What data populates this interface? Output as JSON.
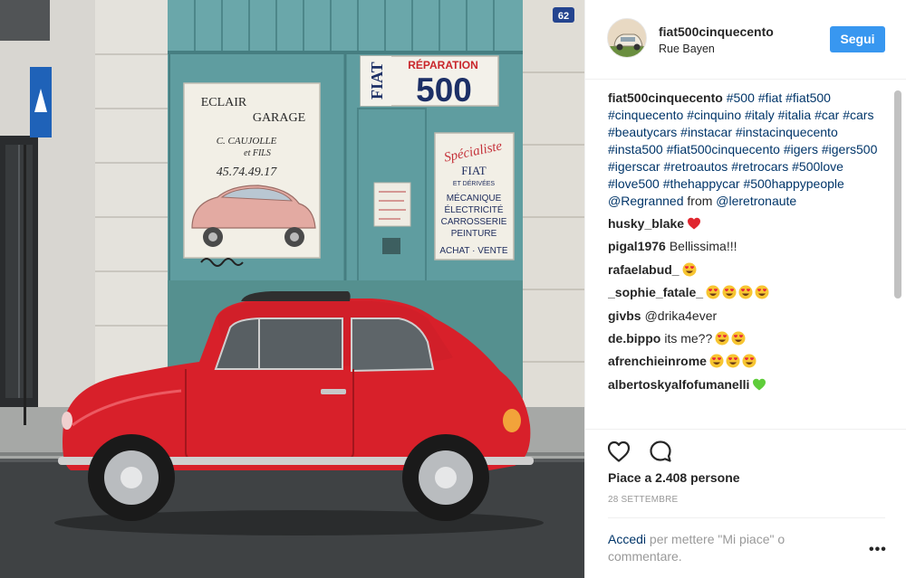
{
  "post": {
    "username": "fiat500cinquecento",
    "location": "Rue Bayen",
    "follow_label": "Segui",
    "photo_signs": {
      "house_number": "62",
      "left_sign": [
        "ECLAIR",
        "GARAGE",
        "C. CAUJOLLE",
        "et FILS",
        "45.74.49.17"
      ],
      "fiat_brand": "FIAT",
      "reparation": "RÉPARATION",
      "model": "500",
      "right_sign": [
        "Spécialiste",
        "FIAT",
        "ET DÉRIVÉES",
        "MÉCANIQUE",
        "ÉLECTRICITÉ",
        "CARROSSERIE",
        "PEINTURE",
        "ACHAT · VENTE"
      ]
    }
  },
  "caption": {
    "username": "fiat500cinquecento",
    "hashtags": [
      "#500",
      "#fiat",
      "#fiat500",
      "#cinquecento",
      "#cinquino",
      "#italy",
      "#italia",
      "#car",
      "#cars",
      "#beautycars",
      "#instacar",
      "#instacinquecento",
      "#insta500",
      "#fiat500cinquecento",
      "#igers",
      "#igers500",
      "#igerscar",
      "#retroautos",
      "#retrocars",
      "#500love",
      "#love500",
      "#thehappycar",
      "#500happypeople"
    ],
    "mention": "@Regranned",
    "from_word": "from",
    "credit": "@leretronaute"
  },
  "comments": [
    {
      "user": "husky_blake",
      "text": "",
      "emoji": [
        "red-heart"
      ]
    },
    {
      "user": "pigal1976",
      "text": "Bellissima!!!",
      "emoji": []
    },
    {
      "user": "rafaelabud_",
      "text": "",
      "emoji": [
        "heart-eyes"
      ]
    },
    {
      "user": "_sophie_fatale_",
      "text": "",
      "emoji": [
        "heart-eyes",
        "heart-eyes",
        "heart-eyes",
        "heart-eyes"
      ]
    },
    {
      "user": "givbs",
      "text": "@drika4ever",
      "text_is_link": true,
      "emoji": []
    },
    {
      "user": "de.bippo",
      "text": "its me??",
      "emoji": [
        "heart-eyes",
        "heart-eyes"
      ]
    },
    {
      "user": "afrenchieinrome",
      "text": "",
      "emoji": [
        "heart-eyes",
        "heart-eyes",
        "heart-eyes"
      ]
    },
    {
      "user": "albertoskyalfofumanelli",
      "text": "",
      "emoji": [
        "green-heart"
      ]
    }
  ],
  "actions": {
    "like_icon": "heart-outline-icon",
    "comment_icon": "comment-bubble-icon"
  },
  "likes_text": "Piace a 2.408 persone",
  "date": "28 SETTEMBRE",
  "login": {
    "link": "Accedi",
    "rest": " per mettere \"Mi piace\" o commentare."
  },
  "more_label": "•••",
  "colors": {
    "accent": "#3897f0",
    "link": "#003569",
    "muted": "#999999",
    "car_red": "#d8202a",
    "door_teal": "#5f9da0"
  }
}
